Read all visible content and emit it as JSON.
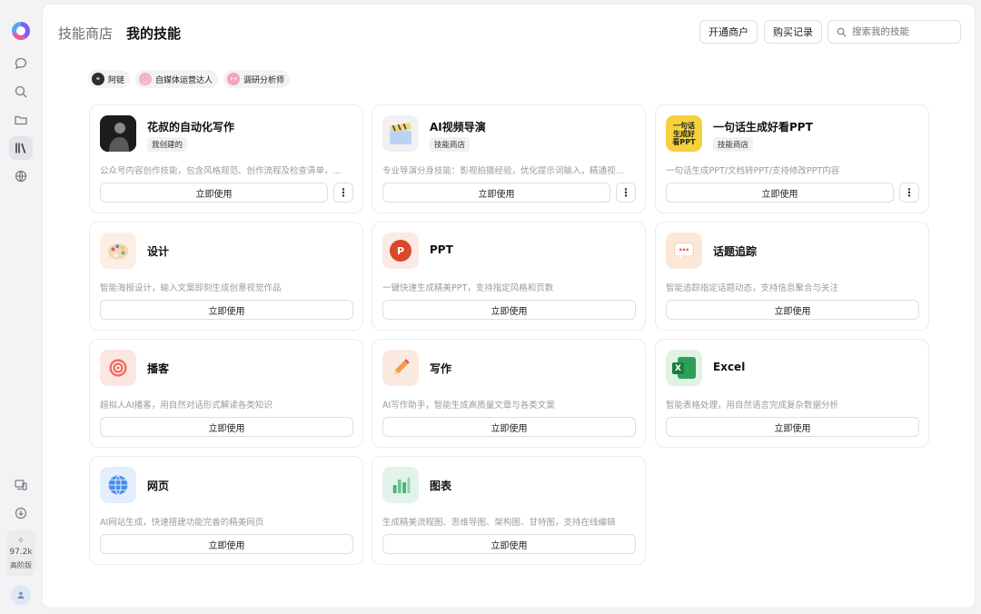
{
  "header": {
    "tab_store": "技能商店",
    "tab_mine": "我的技能",
    "merchant_btn": "开通商户",
    "records_btn": "购买记录",
    "search_placeholder": "搜索我的技能"
  },
  "sidebar": {
    "credits": "97.2k",
    "tier": "高阶版"
  },
  "chips": [
    {
      "label": "阿链",
      "icon": "link-avatar",
      "color": "#2d2d35"
    },
    {
      "label": "自媒体运营达人",
      "icon": "smile-avatar",
      "color": "#f0b6c8"
    },
    {
      "label": "调研分析师",
      "icon": "dots-avatar",
      "color": "#f3a7b7"
    }
  ],
  "cards": [
    {
      "name": "花叔的自动化写作",
      "tag": "我创建的",
      "desc": "公众号内容创作技能，包含风格规范、创作流程及检查清单，...",
      "use_label": "立即使用",
      "more": "⋮",
      "icon": "portrait-icon"
    },
    {
      "name": "AI视频导演",
      "tag": "技能商店",
      "desc": "专业导演分身技能：影视拍摄经验，优化提示词输入，精通视...",
      "use_label": "立即使用",
      "more": "⋮",
      "icon": "clapperboard-icon"
    },
    {
      "name": "一句话生成好看PPT",
      "tag": "技能商店",
      "desc": "一句话生成PPT/文档转PPT/支持修改PPT内容",
      "use_label": "立即使用",
      "more": "⋮",
      "icon": "ppt-poster-icon",
      "icon_text": "一句话生成好看PPT"
    },
    {
      "name": "设计",
      "desc": "智能海报设计，输入文案即刻生成创意视觉作品",
      "use_label": "立即使用",
      "icon": "palette-icon"
    },
    {
      "name": "PPT",
      "desc": "一键快速生成精美PPT，支持指定风格和页数",
      "use_label": "立即使用",
      "icon": "powerpoint-icon",
      "icon_text": "P"
    },
    {
      "name": "话题追踪",
      "desc": "智能追踪指定话题动态，支持信息聚合与关注",
      "use_label": "立即使用",
      "icon": "chat-bubble-icon"
    },
    {
      "name": "播客",
      "desc": "超拟人AI播客，用自然对话形式解读各类知识",
      "use_label": "立即使用",
      "icon": "podcast-icon"
    },
    {
      "name": "写作",
      "desc": "AI写作助手，智能生成高质量文章与各类文案",
      "use_label": "立即使用",
      "icon": "pencil-icon"
    },
    {
      "name": "Excel",
      "desc": "智能表格处理，用自然语言完成复杂数据分析",
      "use_label": "立即使用",
      "icon": "excel-icon",
      "icon_text": "X"
    },
    {
      "name": "网页",
      "desc": "AI网站生成，快速搭建功能完善的精美网页",
      "use_label": "立即使用",
      "icon": "globe-icon"
    },
    {
      "name": "图表",
      "desc": "生成精美流程图、思维导图、架构图、甘特图，支持在线编辑",
      "use_label": "立即使用",
      "icon": "bar-chart-icon"
    }
  ]
}
